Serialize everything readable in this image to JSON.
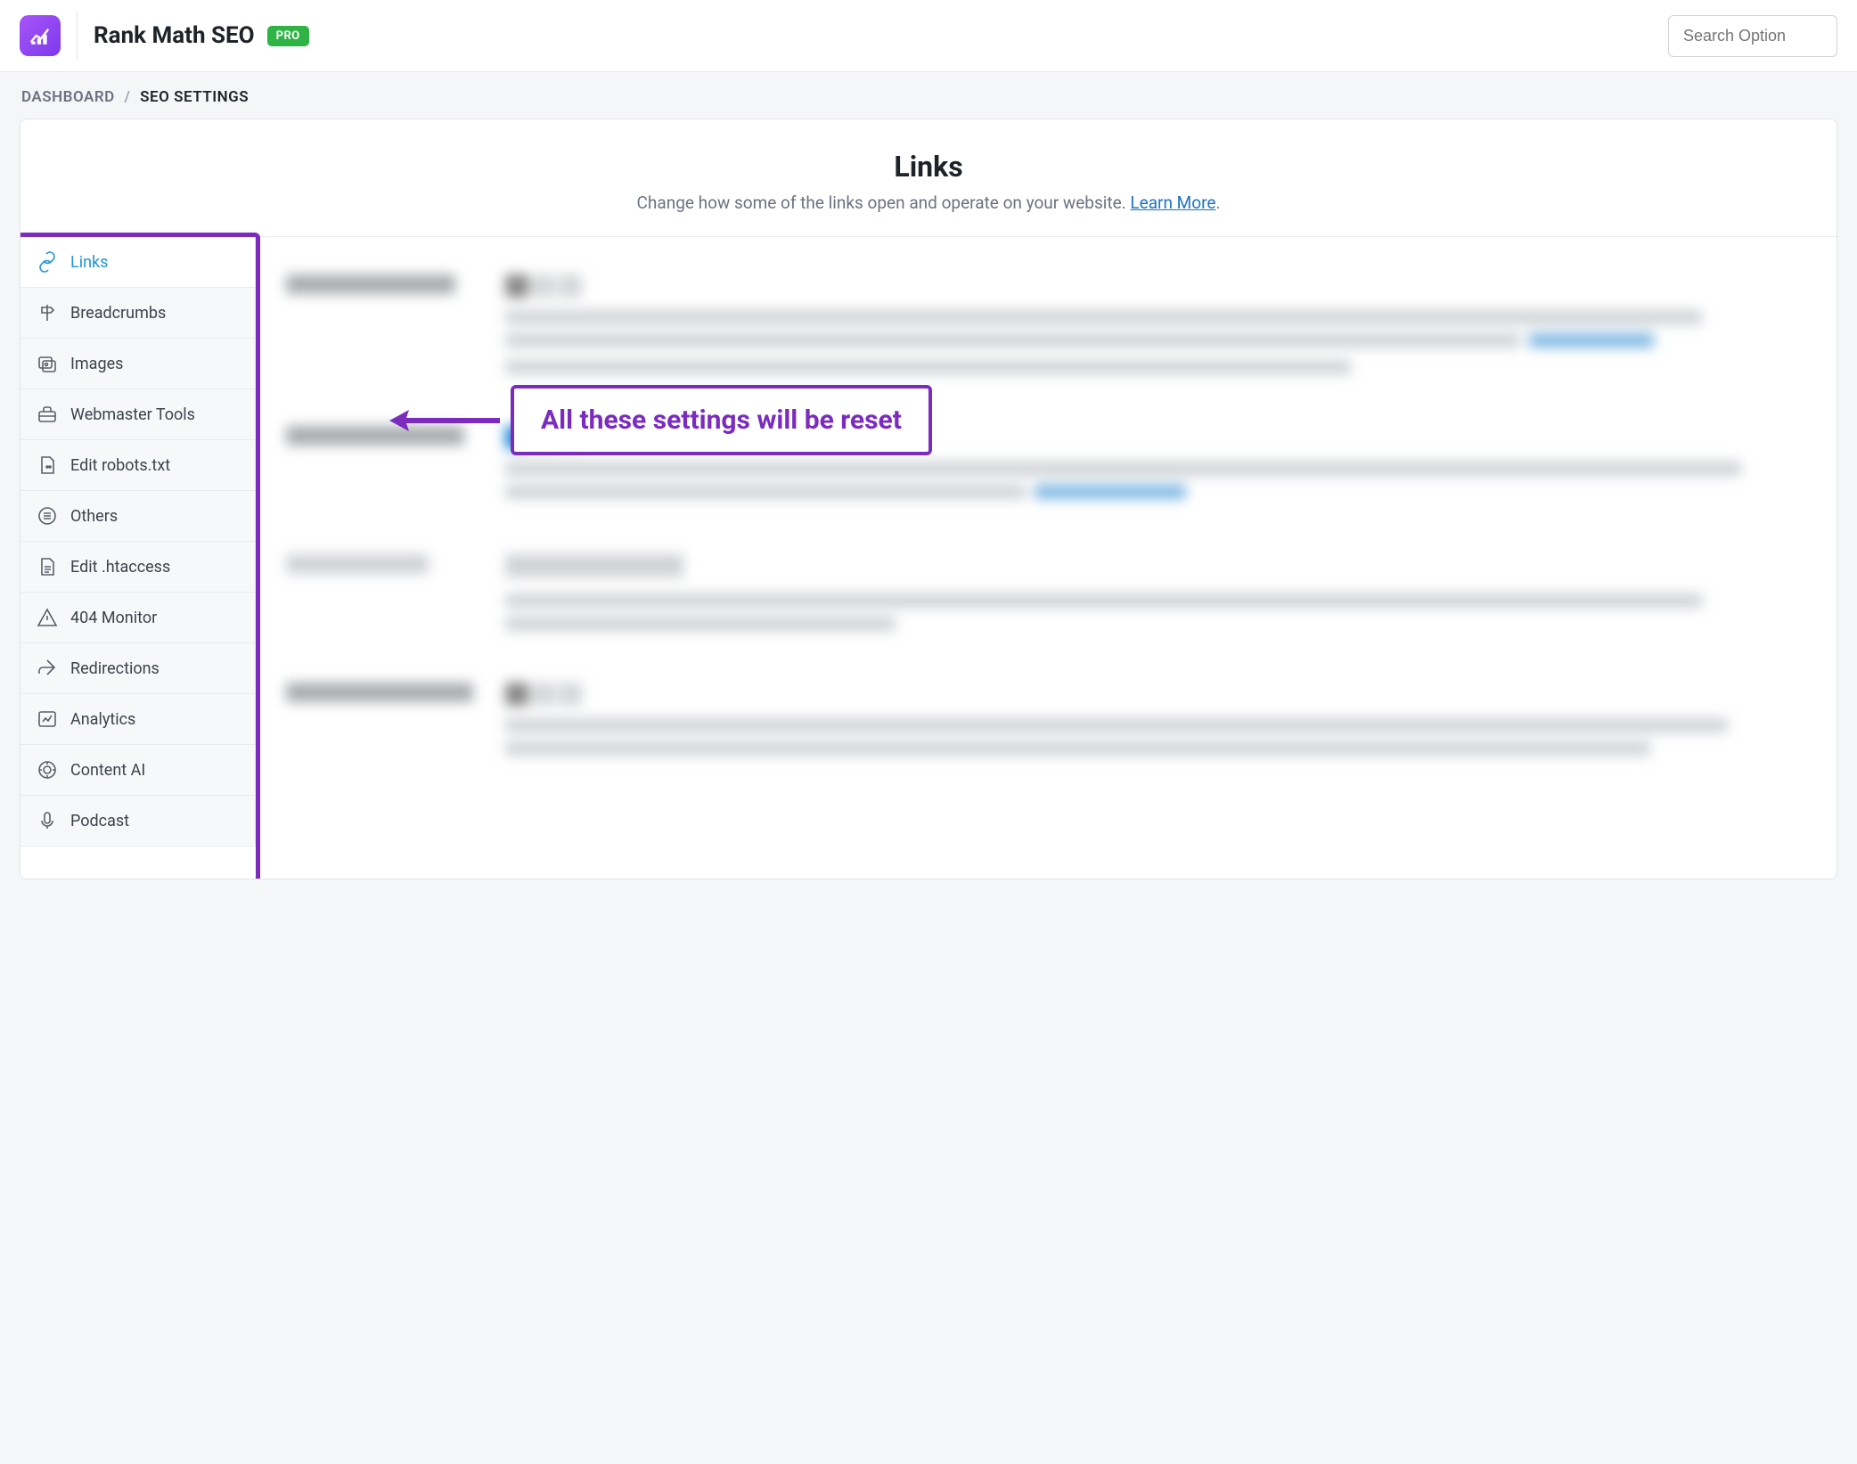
{
  "header": {
    "app_title": "Rank Math SEO",
    "pro_label": "PRO",
    "search_placeholder": "Search Option"
  },
  "breadcrumb": {
    "dashboard": "DASHBOARD",
    "sep": "/",
    "current": "SEO SETTINGS"
  },
  "panel": {
    "title": "Links",
    "subtitle": "Change how some of the links open and operate on your website. ",
    "learn_more": "Learn More"
  },
  "tabs": [
    {
      "id": "links",
      "label": "Links",
      "icon": "links-icon",
      "active": true
    },
    {
      "id": "breadcrumbs",
      "label": "Breadcrumbs",
      "icon": "signpost-icon",
      "active": false
    },
    {
      "id": "images",
      "label": "Images",
      "icon": "images-icon",
      "active": false
    },
    {
      "id": "webmaster",
      "label": "Webmaster Tools",
      "icon": "toolbox-icon",
      "active": false
    },
    {
      "id": "robots",
      "label": "Edit robots.txt",
      "icon": "file-robot-icon",
      "active": false
    },
    {
      "id": "others",
      "label": "Others",
      "icon": "list-icon",
      "active": false
    },
    {
      "id": "htaccess",
      "label": "Edit .htaccess",
      "icon": "file-lines-icon",
      "active": false
    },
    {
      "id": "monitor",
      "label": "404 Monitor",
      "icon": "warning-icon",
      "active": false
    },
    {
      "id": "redirections",
      "label": "Redirections",
      "icon": "redirect-icon",
      "active": false
    },
    {
      "id": "analytics",
      "label": "Analytics",
      "icon": "chart-icon",
      "active": false
    },
    {
      "id": "contentai",
      "label": "Content AI",
      "icon": "ai-icon",
      "active": false
    },
    {
      "id": "podcast",
      "label": "Podcast",
      "icon": "mic-icon",
      "active": false
    }
  ],
  "annotation": {
    "text": "All these settings will be reset"
  }
}
